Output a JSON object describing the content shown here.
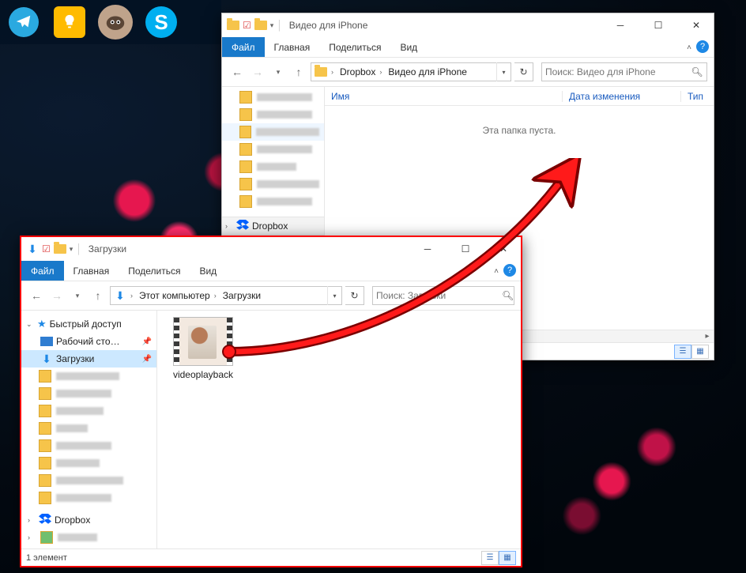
{
  "taskbar": {
    "apps": [
      "telegram",
      "keep",
      "gimp",
      "skype"
    ]
  },
  "top_window": {
    "title": "Видео для iPhone",
    "ribbon": {
      "file": "Файл",
      "home": "Главная",
      "share": "Поделиться",
      "view": "Вид"
    },
    "breadcrumb": {
      "root": "Dropbox",
      "folder": "Видео для iPhone"
    },
    "search_placeholder": "Поиск: Видео для iPhone",
    "columns": {
      "name": "Имя",
      "date": "Дата изменения",
      "type": "Тип"
    },
    "empty_message": "Эта папка пуста.",
    "nav": {
      "dropbox": "Dropbox"
    }
  },
  "bottom_window": {
    "title": "Загрузки",
    "ribbon": {
      "file": "Файл",
      "home": "Главная",
      "share": "Поделиться",
      "view": "Вид"
    },
    "breadcrumb": {
      "root": "Этот компьютер",
      "folder": "Загрузки"
    },
    "search_placeholder": "Поиск: Загрузки",
    "nav": {
      "quick_access": "Быстрый доступ",
      "desktop": "Рабочий сто…",
      "downloads": "Загрузки",
      "dropbox": "Dropbox"
    },
    "file": {
      "name": "videoplayback"
    },
    "status": "1 элемент"
  }
}
